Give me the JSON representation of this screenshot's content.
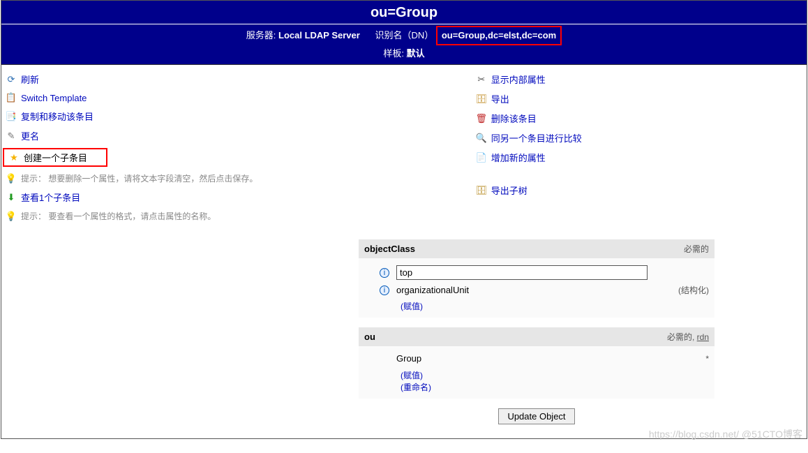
{
  "header": {
    "title": "ou=Group",
    "server_label": "服务器:",
    "server_value": "Local LDAP Server",
    "dn_label": "识别名（DN）",
    "dn_value": "ou=Group,dc=elst,dc=com",
    "template_label": "样板:",
    "template_value": "默认"
  },
  "left_actions": {
    "refresh": "刷新",
    "switch_template": "Switch Template",
    "copy_move": "复制和移动该条目",
    "rename": "更名",
    "create_child": "创建一个子条目",
    "hint_delete": "提示：  想要删除一个属性，请将文本字段清空，然后点击保存。",
    "view_children": "查看1个子条目",
    "hint_format": "提示：  要查看一个属性的格式，请点击属性的名称。"
  },
  "right_actions": {
    "show_internal": "显示内部属性",
    "export": "导出",
    "delete_entry": "删除该条目",
    "compare": "同另一个条目进行比较",
    "add_attr": "增加新的属性",
    "export_subtree": "导出子树"
  },
  "attrs": {
    "objectClass": {
      "name": "objectClass",
      "meta": "必需的",
      "value1": "top",
      "value2": "organizationalUnit",
      "value2_note": "(结构化)",
      "add_value": "(赋值)"
    },
    "ou": {
      "name": "ou",
      "meta_req": "必需的",
      "meta_rdn": "rdn",
      "value": "Group",
      "asterisk": "*",
      "add_value": "(赋值)",
      "rename": "(重命名)"
    }
  },
  "update_button": "Update Object",
  "watermark": "https://blog.csdn.net/  @51CTO博客"
}
